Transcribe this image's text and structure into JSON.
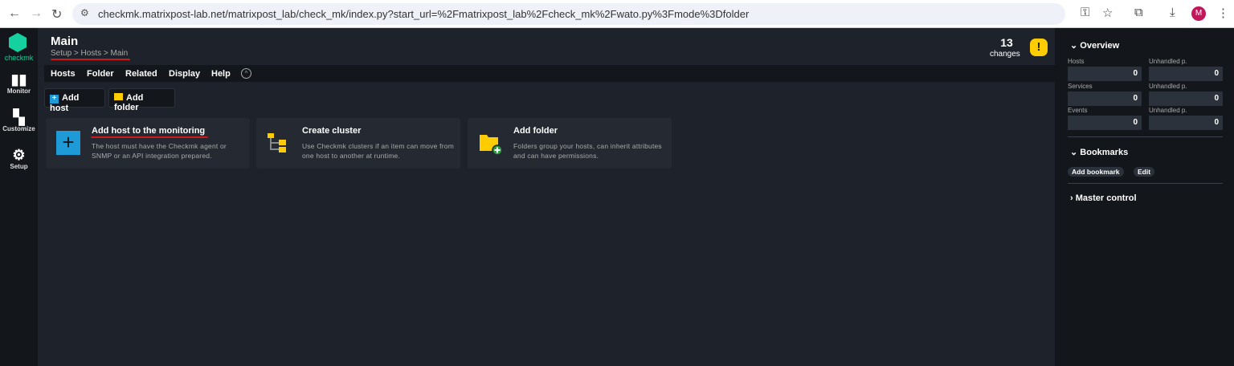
{
  "browser": {
    "url": "checkmk.matrixpost-lab.net/matrixpost_lab/check_mk/index.py?start_url=%2Fmatrixpost_lab%2Fcheck_mk%2Fwato.py%3Fmode%3Dfolder",
    "avatar": "M"
  },
  "logo": "checkmk",
  "leftnav": [
    {
      "label": "Monitor",
      "icon": "bar-chart-icon"
    },
    {
      "label": "Customize",
      "icon": "grid-icon"
    },
    {
      "label": "Setup",
      "icon": "gear-icon"
    }
  ],
  "header": {
    "title": "Main",
    "breadcrumb": "Setup > Hosts > Main",
    "changes_count": "13",
    "changes_label": "changes"
  },
  "menu": [
    "Hosts",
    "Folder",
    "Related",
    "Display",
    "Help"
  ],
  "toolbar": {
    "add_host": "Add host",
    "add_folder": "Add folder"
  },
  "cards": [
    {
      "title": "Add host to the monitoring",
      "desc": "The host must have the Checkmk agent or SNMP or an API integration prepared."
    },
    {
      "title": "Create cluster",
      "desc": "Use Checkmk clusters if an item can move from one host to another at runtime."
    },
    {
      "title": "Add folder",
      "desc": "Folders group your hosts, can inherit attributes and can have permissions."
    }
  ],
  "sidebar": {
    "overview": {
      "title": "Overview",
      "rows": [
        {
          "label": "Hosts",
          "value": "0",
          "unhandled_label": "Unhandled p.",
          "unhandled": "0"
        },
        {
          "label": "Services",
          "value": "0",
          "unhandled_label": "Unhandled p.",
          "unhandled": "0"
        },
        {
          "label": "Events",
          "value": "0",
          "unhandled_label": "Unhandled p.",
          "unhandled": "0"
        }
      ]
    },
    "bookmarks": {
      "title": "Bookmarks",
      "add": "Add bookmark",
      "edit": "Edit"
    },
    "master": {
      "title": "Master control"
    }
  },
  "colors": {
    "accent": "#15d1a0",
    "warning": "#ffcc00",
    "annotation": "#d01818"
  }
}
